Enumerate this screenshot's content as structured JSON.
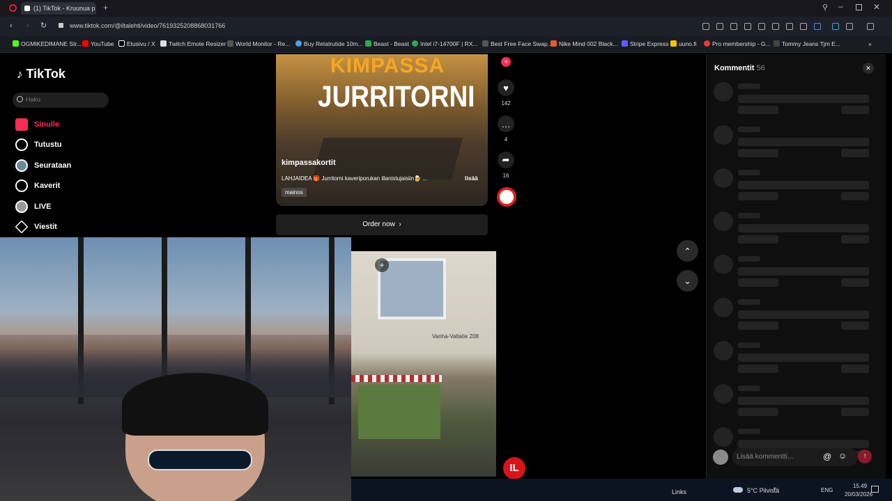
{
  "browser": {
    "tab_title": "(1) TikTok - Kruunua p",
    "url": "www.tiktok.com/@iltalehti/video/7619325208868031766",
    "bookmarks": [
      "OGMIKEDIMANE Str...",
      "YouTube",
      "Etusivu / X",
      "Twitch Emote Resizer",
      "World Monitor - Re...",
      "Buy Retatrutide 10m...",
      "Beast - Beast",
      "Intel i7-14700F | RX...",
      "Best Free Face Swap...",
      "Nike Mind 002 Black...",
      "Stripe Express",
      "uuno.fi",
      "Pro membership - G...",
      "Tommy Jeans Tjm E..."
    ]
  },
  "tiktok": {
    "logo": "TikTok",
    "search_placeholder": "Haku",
    "nav": [
      "Sinulle",
      "Tutustu",
      "Seurataan",
      "Kaverit",
      "LIVE",
      "Viestit"
    ]
  },
  "video": {
    "overlay_top": "KIMPASSA",
    "overlay_title": "JURRITORNI",
    "author": "kimpassakortit",
    "caption": "LAHJAIDEA 🎁 Jurritorni kaveriporukan illanistujaisiin🍺 ...",
    "more": "lisää",
    "ad_label": "mainos",
    "order_button": "Order now",
    "likes": "142",
    "comments": "4",
    "shares": "16"
  },
  "video2": {
    "sign": "Vanha-Valtatie 208"
  },
  "comments_panel": {
    "title": "Kommentit",
    "count": "56",
    "input_placeholder": "Lisää kommentti..."
  },
  "taskbar": {
    "links": "Links",
    "weather": "5°C Pilvistä",
    "lang": "ENG",
    "time": "15.49",
    "date": "20/03/2026"
  },
  "colors": {
    "accent": "#fe2c55",
    "bg": "#000000"
  }
}
